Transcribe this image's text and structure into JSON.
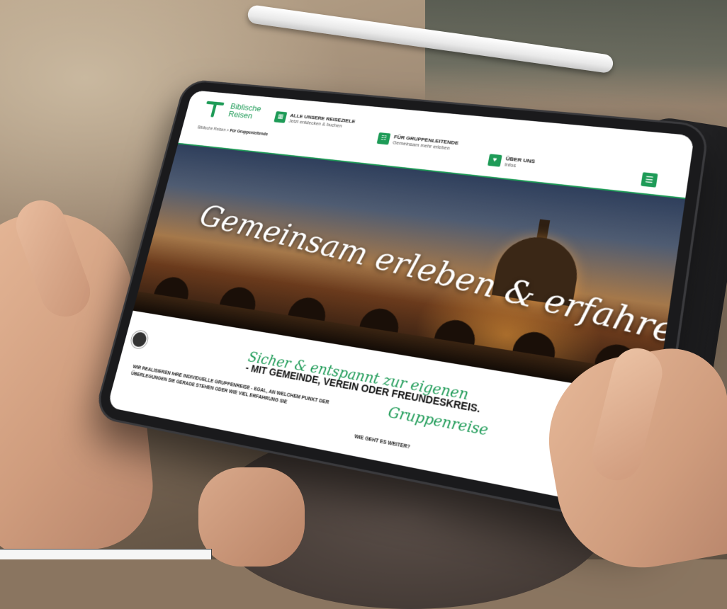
{
  "logo": {
    "line1": "Biblische",
    "line2": "Reisen"
  },
  "nav": [
    {
      "title": "ALLE UNSERE REISEZIELE",
      "sub": "Jetzt entdecken & buchen"
    },
    {
      "title": "FÜR GRUPPENLEITENDE",
      "sub": "Gemeinsam mehr erleben"
    },
    {
      "title": "ÜBER UNS",
      "sub": "Infos"
    }
  ],
  "breadcrumb": {
    "home": "Biblische Reisen",
    "sep": " > ",
    "current": "Für Gruppenleitende"
  },
  "hero": {
    "title": "Gemeinsam erleben & erfahren"
  },
  "section": {
    "script_line": "Sicher & entspannt zur eigenen",
    "script_word": "Gruppenreise",
    "lead": "- MIT GEMEINDE, VEREIN ODER FREUNDESKREIS.",
    "body": "WIR REALISIEREN IHRE INDIVIDUELLE GRUPPENREISE - EGAL, AN WELCHEM PUNKT DER ÜBERLEGUNGEN SIE GERADE STEHEN ODER WIE VIEL ERFAHRUNG SIE",
    "next": "WIE GEHT ES WEITER?"
  },
  "icons": {
    "menu": "hamburger-icon",
    "nav1": "map-icon",
    "nav2": "group-icon",
    "nav3": "heart-icon",
    "fab": "fingerprint-icon"
  },
  "colors": {
    "brand_green": "#1e9b57"
  }
}
